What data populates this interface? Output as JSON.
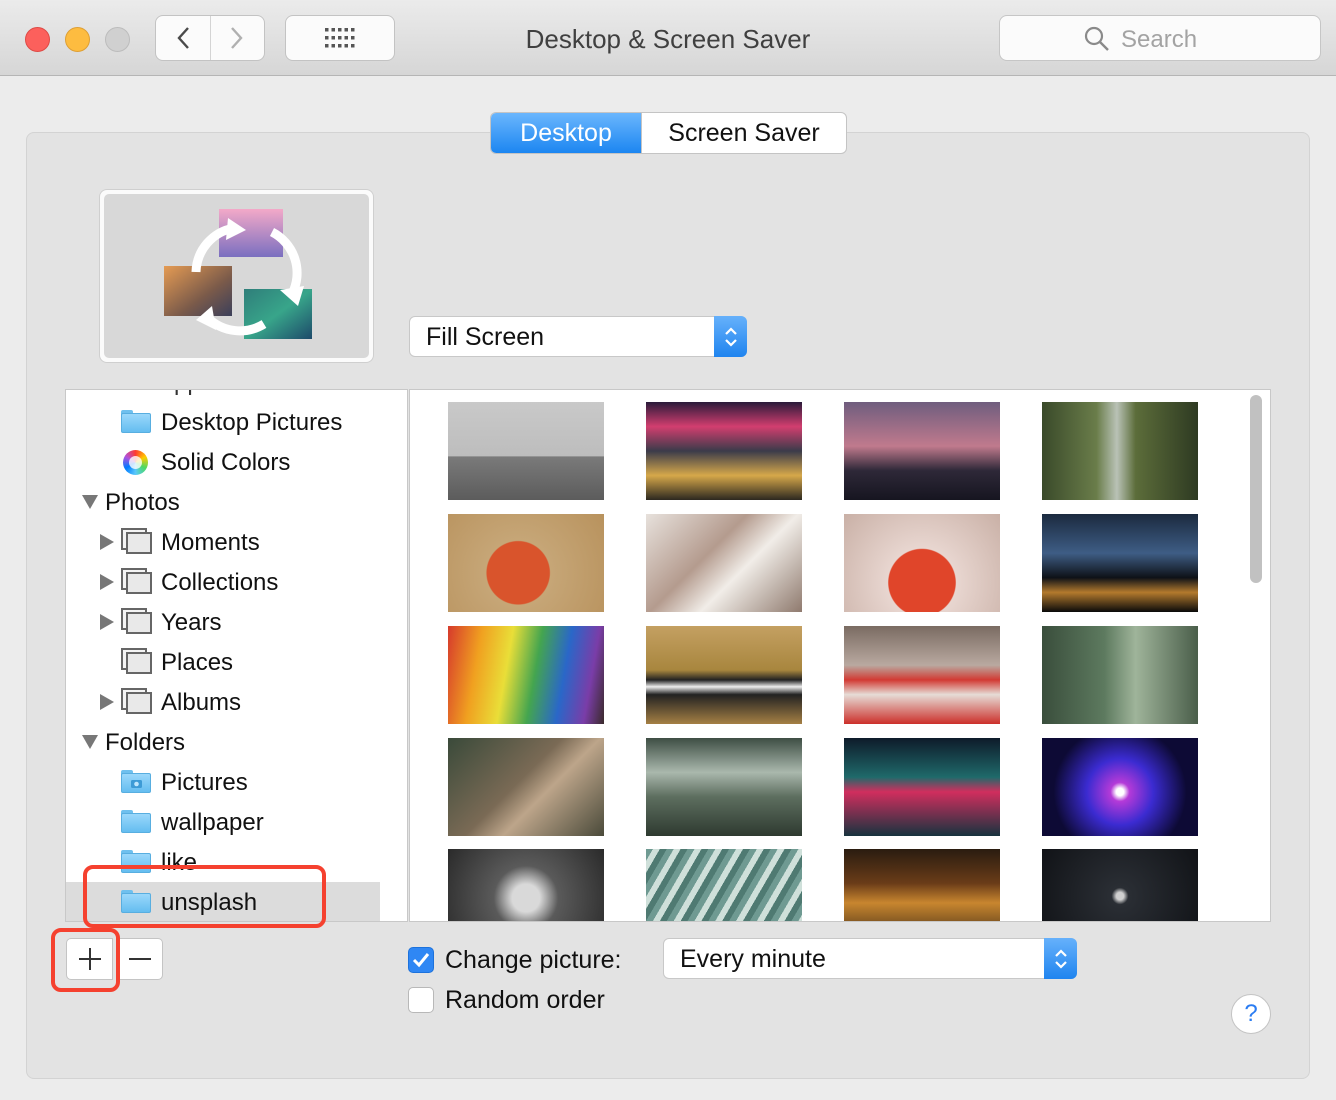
{
  "window": {
    "title": "Desktop & Screen Saver"
  },
  "toolbar": {
    "back_icon": "chevron-left-icon",
    "forward_icon": "chevron-right-icon",
    "grid_icon": "grid-icon"
  },
  "search": {
    "placeholder": "Search"
  },
  "tabs": [
    {
      "label": "Desktop",
      "active": true
    },
    {
      "label": "Screen Saver",
      "active": false
    }
  ],
  "fit": {
    "selected": "Fill Screen"
  },
  "sidebar": {
    "clipped_top_label": "Apple",
    "items": [
      {
        "label": "Desktop Pictures",
        "icon": "folder-icon"
      },
      {
        "label": "Solid Colors",
        "icon": "color-wheel-icon"
      },
      {
        "label": "Photos",
        "icon": "disclosure-down-icon",
        "expanded": true
      },
      {
        "label": "Moments",
        "icon": "album-icon"
      },
      {
        "label": "Collections",
        "icon": "album-icon"
      },
      {
        "label": "Years",
        "icon": "album-icon"
      },
      {
        "label": "Places",
        "icon": "album-icon"
      },
      {
        "label": "Albums",
        "icon": "album-icon"
      },
      {
        "label": "Folders",
        "icon": "disclosure-down-icon",
        "expanded": true
      },
      {
        "label": "Pictures",
        "icon": "folder-camera-icon"
      },
      {
        "label": "wallpaper",
        "icon": "folder-icon"
      },
      {
        "label": "like",
        "icon": "folder-icon"
      },
      {
        "label": "unsplash",
        "icon": "folder-icon",
        "selected": true
      }
    ]
  },
  "buttons": {
    "add": "+",
    "remove": "—",
    "help": "?"
  },
  "change_picture": {
    "label": "Change picture:",
    "checked": true,
    "interval": "Every minute"
  },
  "random_order": {
    "label": "Random order",
    "checked": false
  },
  "colors": {
    "accent": "#1c86f1",
    "highlight": "#f5412f",
    "selected_row": "#dcdcdc"
  },
  "thumbnails": [
    {
      "name": "person-holding-scarf-by-sea",
      "bg": "linear-gradient(180deg,#c9c9c9 0%,#bdbdbd 55%,#7a7a7a 56%,#5c5c5c 100%)"
    },
    {
      "name": "neon-city-crosswalk",
      "bg": "linear-gradient(180deg,#2a1a3a 0%,#d23e6f 25%,#3b3b4a 50%,#d6a84a 75%,#2c2820 100%)"
    },
    {
      "name": "silhouette-at-dusk",
      "bg": "linear-gradient(180deg,#6f5d7e 0%,#c07a8d 45%,#2e2838 70%,#161520 100%)"
    },
    {
      "name": "forest-waterfall",
      "bg": "linear-gradient(90deg,#3a4a2a 0%,#6a7d4a 35%,#b9c2b6 48%,#5c6d3a 60%,#2e3a22 100%)"
    },
    {
      "name": "basketball-hand",
      "bg": "radial-gradient(circle at 45% 60%,#d9542c 0 30%,#c6a677 31%,#b8925d 100%)"
    },
    {
      "name": "snowy-forest",
      "bg": "linear-gradient(135deg,#e7e1dc 0%,#b49b8e 40%,#f1ede8 60%,#8f7a6e 100%)"
    },
    {
      "name": "woman-red-kimono",
      "bg": "radial-gradient(circle at 50% 70%,#e0452a 0 32%,#e8d6d0 33%,#c9b0a6 100%)"
    },
    {
      "name": "night-shoreline",
      "bg": "linear-gradient(180deg,#1b2a3f 0%,#3e5d85 40%,#0e1117 65%,#b37a2d 80%,#0a0a0a 100%)"
    },
    {
      "name": "rainbow-dress",
      "bg": "linear-gradient(100deg,#d63a2c 0%,#f0a020 20%,#e9de38 38%,#44a54f 55%,#2a67c8 72%,#7a3da8 88%,#3a2a2a 100%)"
    },
    {
      "name": "zebras-savanna",
      "bg": "linear-gradient(180deg,#c4a062 0%,#a8863e 45%,#222 55%,#eee 62%,#222 70%,#a58044 100%)"
    },
    {
      "name": "red-dining-table",
      "bg": "linear-gradient(180deg,#7a6b62 0%,#b9a9a0 40%,#d23a33 55%,#e6dcd6 70%,#cc2f2a 100%)"
    },
    {
      "name": "garden-path-people",
      "bg": "linear-gradient(90deg,#3a4e3c 0%,#5d7a5f 40%,#9fb49a 60%,#4a5e4a 100%)"
    },
    {
      "name": "monkey-branch",
      "bg": "linear-gradient(135deg,#3a4a3a 0%,#7a6a55 45%,#bda58a 60%,#4a4a3a 100%)"
    },
    {
      "name": "greenhouse-path",
      "bg": "linear-gradient(180deg,#3e4e44 0%,#aab8ad 35%,#5d6e5f 60%,#2e3a30 100%)"
    },
    {
      "name": "neon-alley-umbrellas",
      "bg": "linear-gradient(180deg,#0e1b2a 0%,#1f6a6a 40%,#d12e5e 55%,#17333f 100%)"
    },
    {
      "name": "concert-stage-lights",
      "bg": "radial-gradient(circle at 50% 55%,#ffffff 0 4%,#b43ad8 10%,#3b2bd1 35%,#0d0a35 70%)"
    },
    {
      "name": "girl-bw-portrait",
      "bg": "radial-gradient(circle at 50% 50%,#d9d9d9 0 15%,#5a5a5a 35%,#2a2a2a 100%)"
    },
    {
      "name": "green-feather-grass",
      "bg": "repeating-linear-gradient(120deg,#6f9a92 0 6px,#cfe0da 6px 12px,#4f7a72 12px 18px)"
    },
    {
      "name": "bicycle-night-street",
      "bg": "linear-gradient(180deg,#2a1c10 0%,#6a3c18 35%,#c8862f 55%,#2c1e12 100%)"
    },
    {
      "name": "moon-dark-sky",
      "bg": "radial-gradient(circle at 50% 48%,#d0d0d0 0 4%,#2a2e34 9%,#101216 100%)"
    }
  ]
}
